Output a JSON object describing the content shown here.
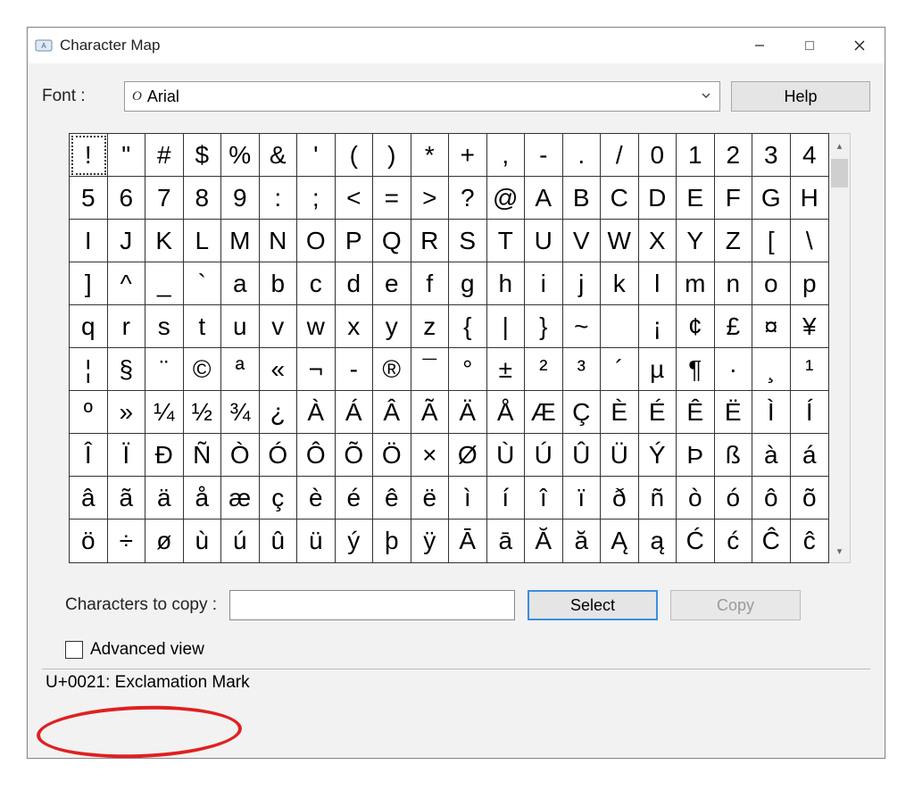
{
  "window": {
    "title": "Character Map"
  },
  "font_row": {
    "label": "Font :",
    "selected": "Arial",
    "help_button": "Help"
  },
  "characters": [
    "!",
    "\"",
    "#",
    "$",
    "%",
    "&",
    "'",
    "(",
    ")",
    "*",
    "+",
    ",",
    "-",
    ".",
    "/",
    "0",
    "1",
    "2",
    "3",
    "4",
    "5",
    "6",
    "7",
    "8",
    "9",
    ":",
    ";",
    "<",
    "=",
    ">",
    "?",
    "@",
    "A",
    "B",
    "C",
    "D",
    "E",
    "F",
    "G",
    "H",
    "I",
    "J",
    "K",
    "L",
    "M",
    "N",
    "O",
    "P",
    "Q",
    "R",
    "S",
    "T",
    "U",
    "V",
    "W",
    "X",
    "Y",
    "Z",
    "[",
    "\\",
    "]",
    "^",
    "_",
    "`",
    "a",
    "b",
    "c",
    "d",
    "e",
    "f",
    "g",
    "h",
    "i",
    "j",
    "k",
    "l",
    "m",
    "n",
    "o",
    "p",
    "q",
    "r",
    "s",
    "t",
    "u",
    "v",
    "w",
    "x",
    "y",
    "z",
    "{",
    "|",
    "}",
    "~",
    " ",
    "¡",
    "¢",
    "£",
    "¤",
    "¥",
    "¦",
    "§",
    "¨",
    "©",
    "ª",
    "«",
    "¬",
    "-",
    "®",
    "¯",
    "°",
    "±",
    "²",
    "³",
    "´",
    "µ",
    "¶",
    "·",
    "¸",
    "¹",
    "º",
    "»",
    "¼",
    "½",
    "¾",
    "¿",
    "À",
    "Á",
    "Â",
    "Ã",
    "Ä",
    "Å",
    "Æ",
    "Ç",
    "È",
    "É",
    "Ê",
    "Ë",
    "Ì",
    "Í",
    "Î",
    "Ï",
    "Ð",
    "Ñ",
    "Ò",
    "Ó",
    "Ô",
    "Õ",
    "Ö",
    "×",
    "Ø",
    "Ù",
    "Ú",
    "Û",
    "Ü",
    "Ý",
    "Þ",
    "ß",
    "à",
    "á",
    "â",
    "ã",
    "ä",
    "å",
    "æ",
    "ç",
    "è",
    "é",
    "ê",
    "ë",
    "ì",
    "í",
    "î",
    "ï",
    "ð",
    "ñ",
    "ò",
    "ó",
    "ô",
    "õ",
    "ö",
    "÷",
    "ø",
    "ù",
    "ú",
    "û",
    "ü",
    "ý",
    "þ",
    "ÿ",
    "Ā",
    "ā",
    "Ă",
    "ă",
    "Ą",
    "ą",
    "Ć",
    "ć",
    "Ĉ",
    "ĉ"
  ],
  "selected_index": 0,
  "copy_row": {
    "label": "Characters to copy :",
    "input_value": "",
    "select_button": "Select",
    "copy_button": "Copy"
  },
  "advanced_view": {
    "label": "Advanced view",
    "checked": false
  },
  "status": "U+0021: Exclamation Mark",
  "annotation": {
    "type": "ellipse-highlight",
    "target": "advanced-view-checkbox"
  }
}
